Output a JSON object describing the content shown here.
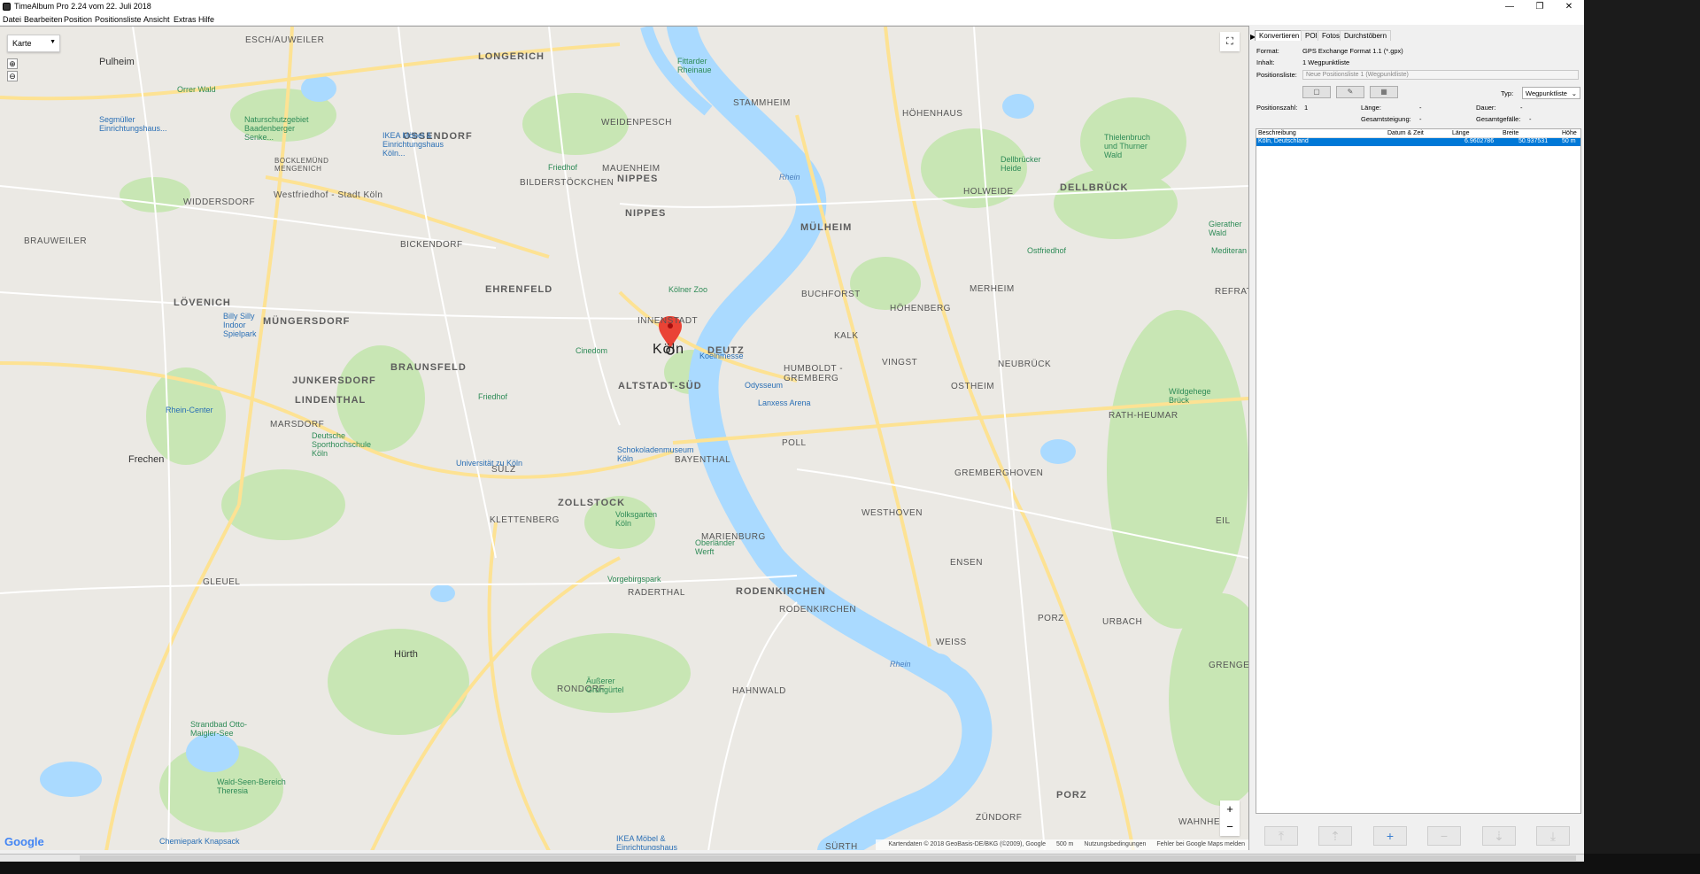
{
  "window": {
    "title": "TimeAlbum Pro 2.24 vom 22. Juli 2018",
    "minimize": "—",
    "restore": "❐",
    "close": "✕"
  },
  "menu": [
    "Datei",
    "Bearbeiten",
    "Position",
    "Positionsliste",
    "Ansicht",
    "Extras",
    "Hilfe"
  ],
  "map": {
    "type_select": "Karte",
    "fullscreen_icon": "⛶",
    "zoom_in": "+",
    "zoom_out": "−",
    "google": "Google",
    "attribution": "Kartendaten © 2018 GeoBasis-DE/BKG (©2009), Google",
    "scale": "500 m",
    "terms": "Nutzungsbedingungen",
    "report": "Fehler bei Google Maps melden",
    "city_label": "Köln",
    "districts": [
      "LONGERICH",
      "ESCH/AUWEILER",
      "OSSENDORF",
      "NIPPES",
      "MAUENHEIM",
      "BILDERSTÖCKCHEN",
      "WEIDENPESCH",
      "STAMMHEIM",
      "HÖHENHAUS",
      "DELLBRÜCK",
      "HOLWEIDE",
      "MÜLHEIM",
      "BICKENDORF",
      "EHRENFELD",
      "LÖVENICH",
      "MÜNGERSDORF",
      "BRAUNSFELD",
      "JUNKERSDORF",
      "LINDENTHAL",
      "DEUTZ",
      "ALTSTADT-SÜD",
      "INNENSTADT",
      "BUCHFORST",
      "HÖHENBERG",
      "MERHEIM",
      "KALK",
      "VINGST",
      "HUMBOLDT - GREMBERG",
      "OSTHEIM",
      "NEUBRÜCK",
      "RATH-HEUMAR",
      "MARSDORF",
      "WIDDERSDORF",
      "BRAUWEILER",
      "SÜLZ",
      "ZOLLSTOCK",
      "KLETTENBERG",
      "BAYENTHAL",
      "POLL",
      "GREMBERGHOVEN",
      "WESTHOVEN",
      "ENSEN",
      "MARIENBURG",
      "RADERTHAL",
      "RODENKIRCHEN",
      "RODENKIRCHEN",
      "WEISS",
      "PORZ",
      "URBACH",
      "GRENGEL",
      "EIL",
      "GLEUEL",
      "RONDORF",
      "HAHNWALD",
      "SÜRTH",
      "ZÜNDORF",
      "PORZ",
      "WAHNHEIDE",
      "BOCKLEMÜND MENGENICH",
      "REFRATH",
      "Pulheim",
      "Frechen",
      "Hürth"
    ],
    "pois": [
      "Orrer Wald",
      "Segmüller Einrichtungshaus...",
      "Naturschutzgebiet Baadenberger Senke...",
      "IKEA Möbel & Einrichtungshaus Köln...",
      "Friedhof",
      "Westfriedhof - Stadt Köln",
      "Kölner Zoo",
      "Cinedom",
      "Koelnmesse",
      "Odysseum",
      "Lanxess Arena",
      "Schokoladenmuseum Köln",
      "Universität zu Köln",
      "Friedhof",
      "Rhein-Center",
      "Billy Silly Indoor Spielpark",
      "Deutsche Sporthochschule Köln",
      "Volksgarten Köln",
      "Oberländer Werft",
      "Vorgebirgspark",
      "Äußerer Grüngürtel",
      "Strandbad Otto-Maigler-See",
      "Wald-Seen-Bereich Theresia",
      "Chemiepark Knapsack",
      "IKEA Möbel & Einrichtungshaus Köln...",
      "Dellbrücker Heide",
      "Thielenbruch und Thurner Wald",
      "Gierather Wald",
      "Ostfriedhof",
      "Wildgehege Brück",
      "Mediteran",
      "Fittarder Rheinaue"
    ],
    "river": "Rhein"
  },
  "panel": {
    "tabs": [
      "Konvertieren",
      "POI",
      "Fotos",
      "Durchstöbern"
    ],
    "format_label": "Format:",
    "format_value": "GPS Exchange Format 1.1 (*.gpx)",
    "inhalt_label": "Inhalt:",
    "inhalt_value": "1 Wegpunktliste",
    "positionsliste_label": "Positionsliste:",
    "positionsliste_value": "Neue Positionsliste 1 (Wegpunktliste)",
    "typ_label": "Typ:",
    "typ_value": "Wegpunktliste",
    "positionszahl_label": "Positionszahl:",
    "positionszahl_value": "1",
    "laenge_label": "Länge:",
    "laenge_value": "-",
    "dauer_label": "Dauer:",
    "dauer_value": "-",
    "gesamtsteigung_label": "Gesamtsteigung:",
    "gesamtsteigung_value": "-",
    "gesamtgefaelle_label": "Gesamtgefälle:",
    "gesamtgefaelle_value": "-",
    "table": {
      "headers": [
        "Beschreibung",
        "Datum & Zeit",
        "Länge",
        "Breite",
        "Höhe"
      ],
      "rows": [
        [
          "Köln, Deutschland",
          "",
          "6.9602786",
          "50.937531",
          "50 m"
        ]
      ]
    },
    "bottom_buttons": [
      "⤒",
      "⇡",
      "+",
      "−",
      "⇣",
      "⤓"
    ]
  },
  "colors": {
    "selection": "#0078d7",
    "water": "#aadaff",
    "park": "#c8e6b4",
    "road_major": "#fde293",
    "marker": "#ea4335"
  }
}
